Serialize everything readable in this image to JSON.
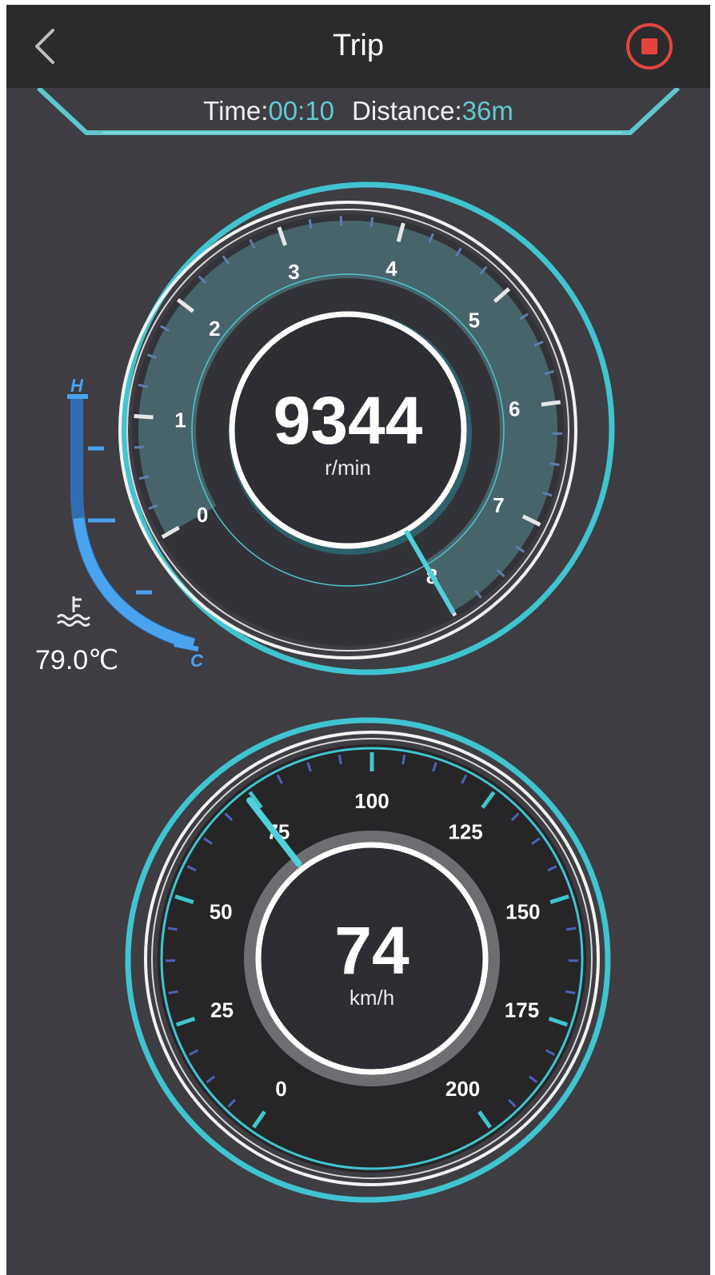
{
  "header": {
    "title": "Trip",
    "back_icon": "chevron-left-icon",
    "stop_icon": "stop-icon",
    "stop_color": "#e2453c"
  },
  "trip": {
    "time_label": "Time:",
    "time_value": "00:10",
    "distance_label": "Distance:",
    "distance_value": "36m",
    "value_color": "#63c9d1"
  },
  "temperature": {
    "value_text": "79.0℃",
    "hot_label": "H",
    "cold_label": "C",
    "icon": "coolant-temperature-icon",
    "level_fraction": 0.6,
    "color": "#3b8fe0"
  },
  "rpm_gauge": {
    "value": "9344",
    "unit": "r/min",
    "scale_labels": [
      "0",
      "1",
      "2",
      "3",
      "4",
      "5",
      "6",
      "7",
      "8"
    ],
    "scale_min": 0,
    "scale_max": 8,
    "needle_value": 8,
    "accent": "#40c4d0"
  },
  "speed_gauge": {
    "value": "74",
    "unit": "km/h",
    "scale_labels": [
      "0",
      "25",
      "50",
      "75",
      "100",
      "125",
      "150",
      "175",
      "200"
    ],
    "scale_min": 0,
    "scale_max": 200,
    "needle_value": 74,
    "accent": "#40c4d0"
  }
}
